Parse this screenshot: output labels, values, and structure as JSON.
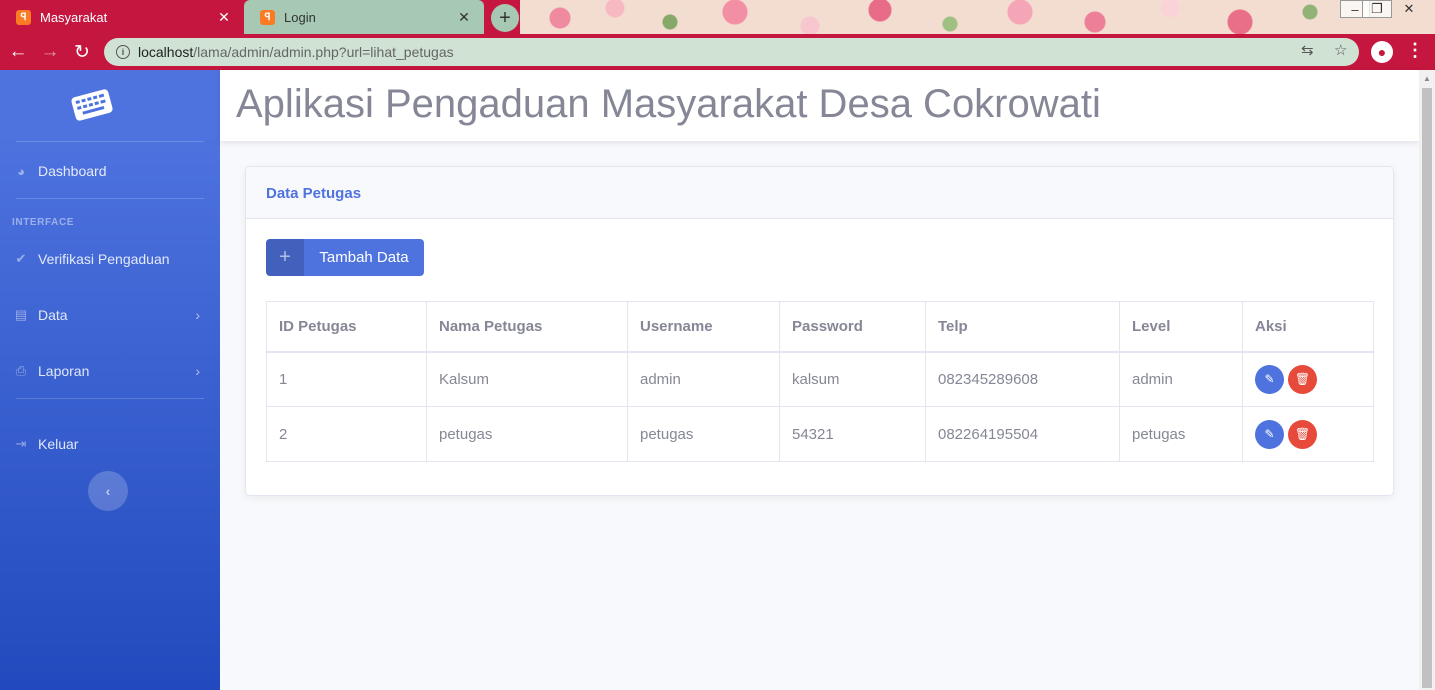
{
  "browser": {
    "tabs": [
      {
        "title": "Masyarakat",
        "active": true
      },
      {
        "title": "Login",
        "active": false
      }
    ],
    "url": {
      "host": "localhost",
      "path": "/lama/admin/admin.php?url=lihat_petugas"
    },
    "accent": "#c4163f"
  },
  "sidebar": {
    "items": [
      {
        "label": "Dashboard",
        "icon": "tachometer-icon"
      },
      {
        "label": "Verifikasi Pengaduan",
        "icon": "check-icon"
      },
      {
        "label": "Data",
        "icon": "file-icon",
        "has_submenu": true
      },
      {
        "label": "Laporan",
        "icon": "print-icon",
        "has_submenu": true
      },
      {
        "label": "Keluar",
        "icon": "sign-out-icon"
      }
    ],
    "heading": "INTERFACE",
    "gradient": [
      "#4e73df",
      "#224abe"
    ]
  },
  "header": {
    "title": "Aplikasi Pengaduan Masyarakat Desa Cokrowati"
  },
  "card": {
    "title": "Data Petugas",
    "add_button": "Tambah Data",
    "columns": [
      "ID Petugas",
      "Nama Petugas",
      "Username",
      "Password",
      "Telp",
      "Level",
      "Aksi"
    ],
    "rows": [
      [
        "1",
        "Kalsum",
        "admin",
        "kalsum",
        "082345289608",
        "admin"
      ],
      [
        "2",
        "petugas",
        "petugas",
        "54321",
        "082264195504",
        "petugas"
      ]
    ]
  },
  "colors": {
    "primary": "#4e73df",
    "danger": "#e74a3b",
    "text": "#858796"
  }
}
